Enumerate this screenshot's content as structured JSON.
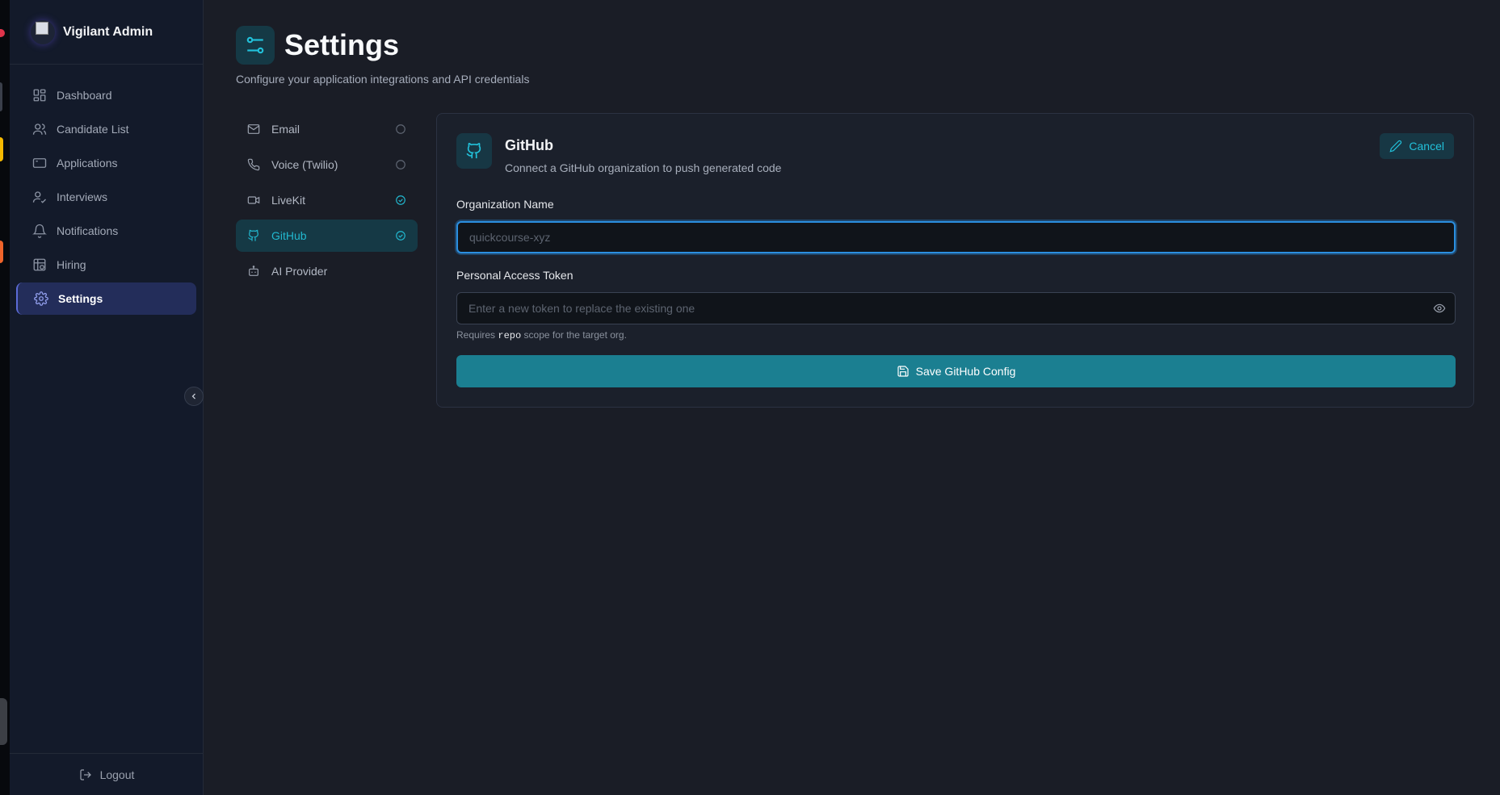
{
  "app": {
    "name": "Vigilant Admin"
  },
  "sidebar": {
    "items": [
      {
        "label": "Dashboard",
        "icon": "dashboard-icon"
      },
      {
        "label": "Candidate List",
        "icon": "users-icon"
      },
      {
        "label": "Applications",
        "icon": "applications-icon"
      },
      {
        "label": "Interviews",
        "icon": "interviews-icon"
      },
      {
        "label": "Notifications",
        "icon": "bell-icon"
      },
      {
        "label": "Hiring",
        "icon": "hiring-icon"
      },
      {
        "label": "Settings",
        "icon": "gear-icon",
        "active": true
      }
    ],
    "logout_label": "Logout"
  },
  "page": {
    "title": "Settings",
    "subtitle": "Configure your application integrations and API credentials"
  },
  "integrations": [
    {
      "label": "Email",
      "icon": "mail-icon",
      "status": "unconfigured"
    },
    {
      "label": "Voice (Twilio)",
      "icon": "phone-icon",
      "status": "unconfigured"
    },
    {
      "label": "LiveKit",
      "icon": "video-icon",
      "status": "configured"
    },
    {
      "label": "GitHub",
      "icon": "github-icon",
      "status": "configured",
      "active": true
    },
    {
      "label": "AI Provider",
      "icon": "bot-icon",
      "status": "none"
    }
  ],
  "card": {
    "title": "GitHub",
    "description": "Connect a GitHub organization to push generated code",
    "cancel_label": "Cancel",
    "org_label": "Organization Name",
    "org_value": "",
    "org_placeholder": "quickcourse-xyz",
    "token_label": "Personal Access Token",
    "token_value": "",
    "token_placeholder": "Enter a new token to replace the existing one",
    "hint_prefix": "Requires",
    "hint_code": "repo",
    "hint_suffix": "scope for the target org.",
    "save_label": "Save GitHub Config"
  },
  "colors": {
    "accent": "#22b8cf",
    "active_nav": "#232d5a",
    "save_button": "#1b7f91",
    "focus_ring": "#2b8fe0"
  }
}
